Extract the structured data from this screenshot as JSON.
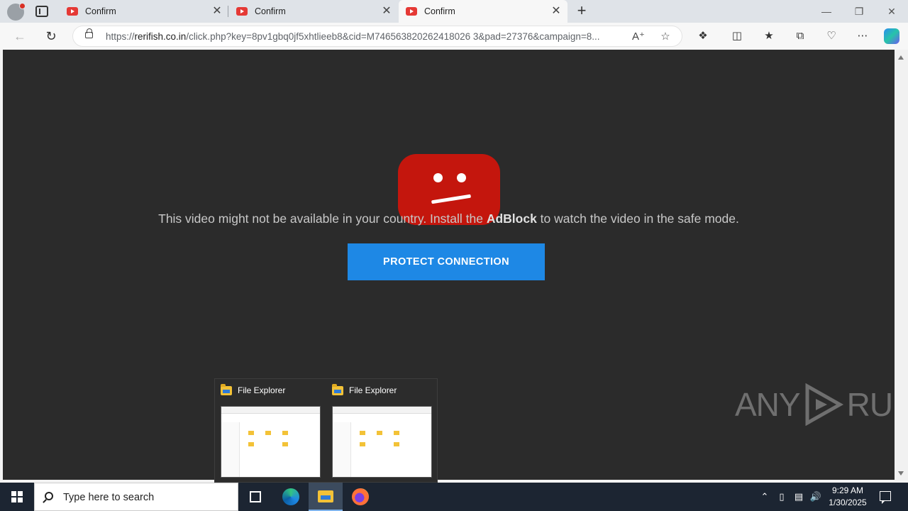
{
  "browser": {
    "tabs": [
      {
        "title": "Confirm",
        "active": false
      },
      {
        "title": "Confirm",
        "active": false
      },
      {
        "title": "Confirm",
        "active": true
      }
    ],
    "new_tab_symbol": "+",
    "close_symbol": "✕",
    "window_controls": {
      "minimize": "—",
      "restore": "❐",
      "close": "✕"
    },
    "address": {
      "scheme": "https://",
      "host": "rerifish.co.in",
      "path": "/click.php?key=8pv1gbq0jf5xhtlieeb8&cid=M746563820262418026 3&pad=27376&campaign=8..."
    },
    "toolbar_icons": [
      "back-icon",
      "refresh-icon",
      "read-aloud-icon",
      "favorite-star-icon",
      "extensions-icon",
      "split-screen-icon",
      "favorites-icon",
      "collections-icon",
      "browser-essentials-icon",
      "more-icon",
      "copilot-icon"
    ]
  },
  "page": {
    "message_pre": "This video might not be available in your country. Install the ",
    "message_bold": "AdBlock",
    "message_post": " to watch the video in the safe mode.",
    "button_label": "PROTECT CONNECTION",
    "colors": {
      "background": "#2b2b2b",
      "logo_red": "#c4160d",
      "button_blue": "#1e88e5"
    }
  },
  "watermark": {
    "left": "ANY",
    "right": "RUN"
  },
  "thumbnails": [
    {
      "title": "File Explorer"
    },
    {
      "title": "File Explorer"
    }
  ],
  "taskbar": {
    "search_placeholder": "Type here to search",
    "time": "9:29 AM",
    "date": "1/30/2025",
    "apps": [
      "task-view",
      "microsoft-edge",
      "file-explorer",
      "firefox"
    ]
  }
}
